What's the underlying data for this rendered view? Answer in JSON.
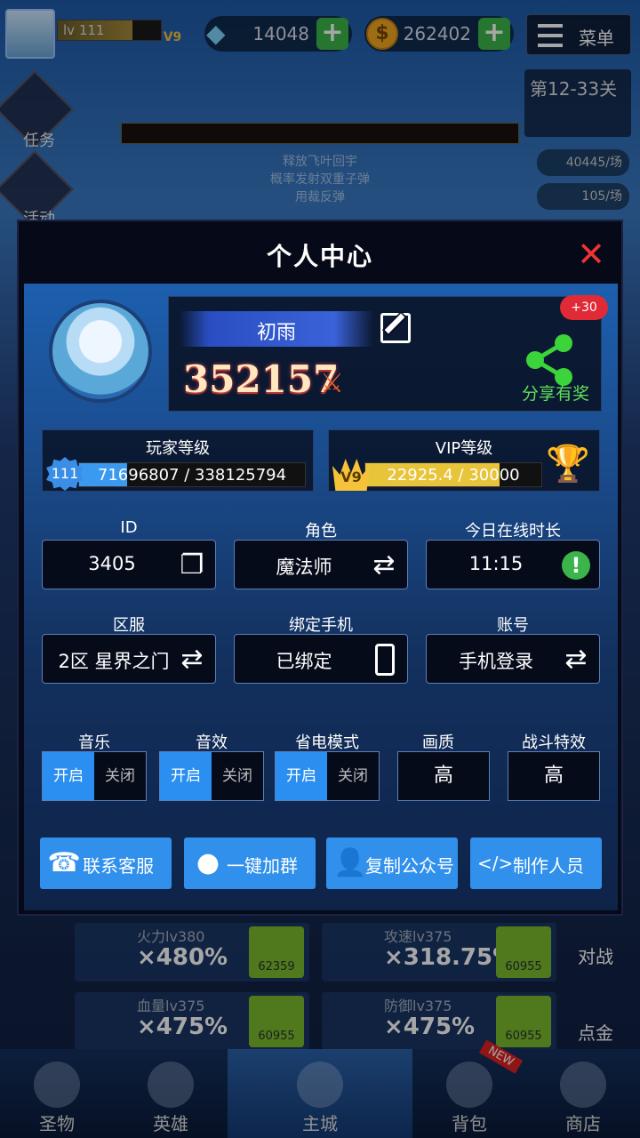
{
  "hud": {
    "level": "lv 111",
    "vip": "V9",
    "gems": "14048",
    "gold": "262402",
    "menu": "菜单",
    "stage": "第12-33关",
    "rate1": "40445/场",
    "rate2": "105/场",
    "task": "任务",
    "event": "活动",
    "banner_lines": [
      "释放飞叶回宇",
      "概率发射双重子弹",
      "用裁反弹"
    ]
  },
  "panel": {
    "title": "个人中心",
    "name": "初雨",
    "power": "352157",
    "share_label": "分享有奖",
    "share_badge": "+30",
    "player_level": {
      "title": "玩家等级",
      "level": "111",
      "progress_text": "71696807 / 338125794",
      "progress": 0.212
    },
    "vip_level": {
      "title": "VIP等级",
      "level": "V9",
      "progress_text": "22925.4 / 30000",
      "progress": 0.764
    },
    "fields": [
      {
        "label": "ID",
        "value": "3405",
        "icon": "copy-icon"
      },
      {
        "label": "角色",
        "value": "魔法师",
        "icon": "swap-icon"
      },
      {
        "label": "今日在线时长",
        "value": "11:15",
        "icon": "warning-icon"
      },
      {
        "label": "区服",
        "value": "2区 星界之门",
        "icon": "swap-icon"
      },
      {
        "label": "绑定手机",
        "value": "已绑定",
        "icon": "phone-icon"
      },
      {
        "label": "账号",
        "value": "手机登录",
        "icon": "swap-icon"
      }
    ],
    "toggles": [
      {
        "label": "音乐",
        "on": "开启",
        "off": "关闭"
      },
      {
        "label": "音效",
        "on": "开启",
        "off": "关闭"
      },
      {
        "label": "省电模式",
        "on": "开启",
        "off": "关闭"
      }
    ],
    "quality": {
      "label": "画质",
      "value": "高"
    },
    "battle_fx": {
      "label": "战斗特效",
      "value": "高"
    },
    "actions": [
      {
        "label": "联系客服",
        "icon": "customer-service-icon"
      },
      {
        "label": "一键加群",
        "icon": "penguin-icon"
      },
      {
        "label": "复制公众号",
        "icon": "user-icon"
      },
      {
        "label": "制作人员",
        "icon": "code-icon"
      }
    ]
  },
  "bottom": {
    "stats": [
      {
        "name": "火力lv380",
        "value": "×480%",
        "cost": "62359"
      },
      {
        "name": "攻速lv375",
        "value": "×318.75%",
        "cost": "60955"
      },
      {
        "name": "血量lv375",
        "value": "×475%",
        "cost": "60955"
      },
      {
        "name": "防御lv375",
        "value": "×475%",
        "cost": "60955"
      }
    ],
    "side_right": [
      "对战",
      "点金"
    ],
    "nav": [
      "圣物",
      "英雄",
      "主城",
      "背包",
      "商店"
    ],
    "new_tag": "NEW"
  }
}
